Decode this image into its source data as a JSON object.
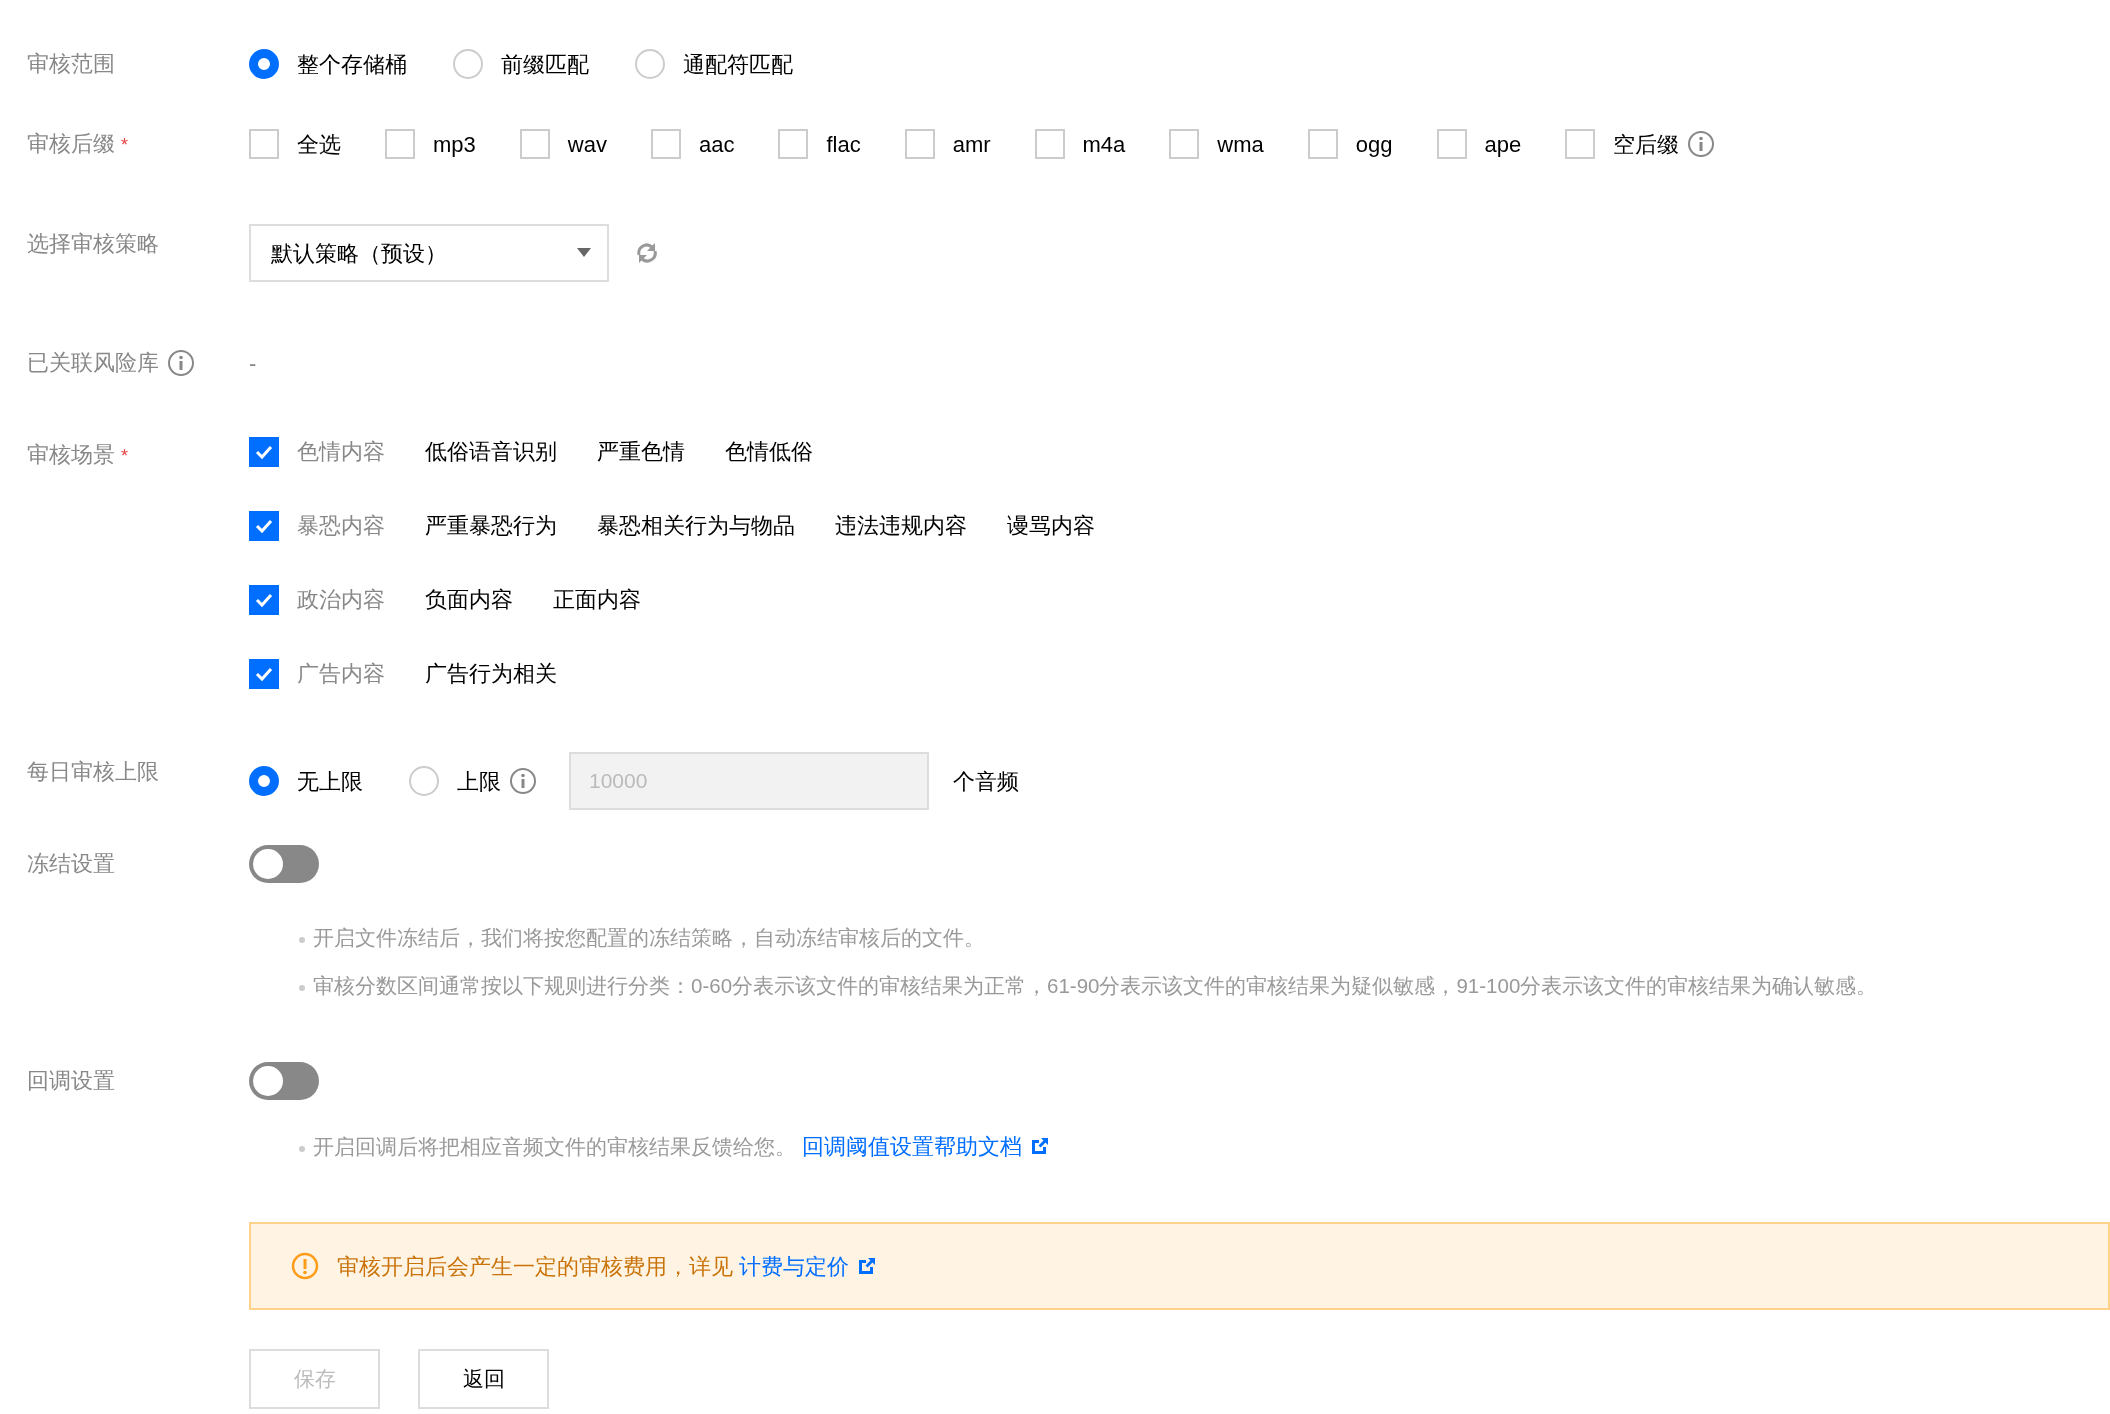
{
  "scope": {
    "label": "审核范围",
    "options": [
      {
        "label": "整个存储桶",
        "selected": true
      },
      {
        "label": "前缀匹配",
        "selected": false
      },
      {
        "label": "通配符匹配",
        "selected": false
      }
    ]
  },
  "suffix": {
    "label": "审核后缀",
    "required_mark": "*",
    "options": [
      {
        "label": "全选",
        "checked": false
      },
      {
        "label": "mp3",
        "checked": false
      },
      {
        "label": "wav",
        "checked": false
      },
      {
        "label": "aac",
        "checked": false
      },
      {
        "label": "flac",
        "checked": false
      },
      {
        "label": "amr",
        "checked": false
      },
      {
        "label": "m4a",
        "checked": false
      },
      {
        "label": "wma",
        "checked": false
      },
      {
        "label": "ogg",
        "checked": false
      },
      {
        "label": "ape",
        "checked": false
      },
      {
        "label": "空后缀",
        "checked": false
      }
    ]
  },
  "policy": {
    "label": "选择审核策略",
    "value": "默认策略（预设）"
  },
  "risk_library": {
    "label": "已关联风险库",
    "value": "-"
  },
  "scenes": {
    "label": "审核场景",
    "required_mark": "*",
    "groups": [
      {
        "label": "色情内容",
        "checked": true,
        "items": [
          "低俗语音识别",
          "严重色情",
          "色情低俗"
        ]
      },
      {
        "label": "暴恐内容",
        "checked": true,
        "items": [
          "严重暴恐行为",
          "暴恐相关行为与物品",
          "违法违规内容",
          "谩骂内容"
        ]
      },
      {
        "label": "政治内容",
        "checked": true,
        "items": [
          "负面内容",
          "正面内容"
        ]
      },
      {
        "label": "广告内容",
        "checked": true,
        "items": [
          "广告行为相关"
        ]
      }
    ]
  },
  "daily_limit": {
    "label": "每日审核上限",
    "options": [
      {
        "label": "无上限",
        "selected": true,
        "info": false
      },
      {
        "label": "上限",
        "selected": false,
        "info": true
      }
    ],
    "placeholder": "10000",
    "disabled": true,
    "unit": "个音频"
  },
  "freeze": {
    "label": "冻结设置",
    "on": false,
    "notes": [
      "开启文件冻结后，我们将按您配置的冻结策略，自动冻结审核后的文件。",
      "审核分数区间通常按以下规则进行分类：0-60分表示该文件的审核结果为正常，61-90分表示该文件的审核结果为疑似敏感，91-100分表示该文件的审核结果为确认敏感。"
    ]
  },
  "callback": {
    "label": "回调设置",
    "on": false,
    "note": "开启回调后将把相应音频文件的审核结果反馈给您。",
    "link": "回调阈值设置帮助文档"
  },
  "alert": {
    "text": "审核开启后会产生一定的审核费用，详见",
    "link": "计费与定价"
  },
  "buttons": [
    {
      "label": "保存",
      "disabled": true
    },
    {
      "label": "返回",
      "disabled": false
    }
  ]
}
